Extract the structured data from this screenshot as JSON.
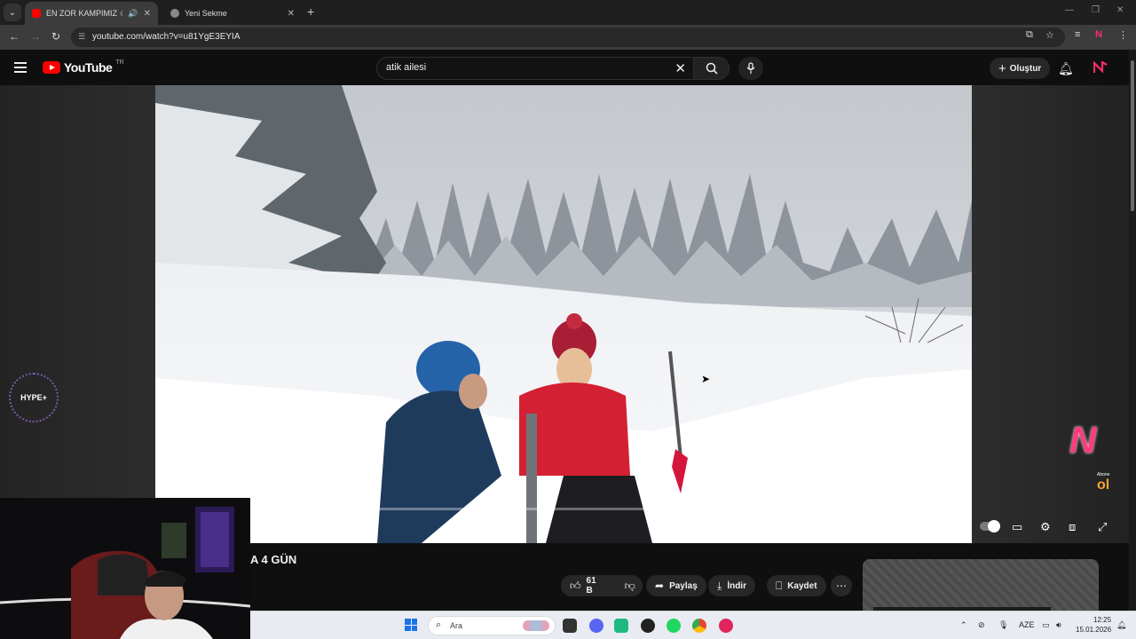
{
  "browser": {
    "tabs": [
      {
        "label": "EN ZOR KAMPIMIZ 🌨 KAR",
        "active": true,
        "audio": true
      },
      {
        "label": "Yeni Sekme",
        "active": false
      }
    ],
    "url": "youtube.com/watch?v=u81YgE3EYIA"
  },
  "youtube": {
    "logo_text": "YouTube",
    "country_code": "TR",
    "search_value": "atik ailesi",
    "create_label": "Oluştur"
  },
  "video": {
    "title_visible": "A 4 GÜN",
    "like_count": "61 B",
    "share_label": "Paylaş",
    "download_label": "İndir",
    "save_label": "Kaydet"
  },
  "overlays": {
    "hype_label": "HYPE+",
    "abone_small": "Abone",
    "abone_big": "ol"
  },
  "taskbar": {
    "search_placeholder": "Ara",
    "lang": "AZE",
    "time": "12:25",
    "date": "15.01.2026"
  },
  "colors": {
    "yt_red": "#ff0000",
    "bg": "#0f0f0f",
    "chip": "#272727"
  }
}
